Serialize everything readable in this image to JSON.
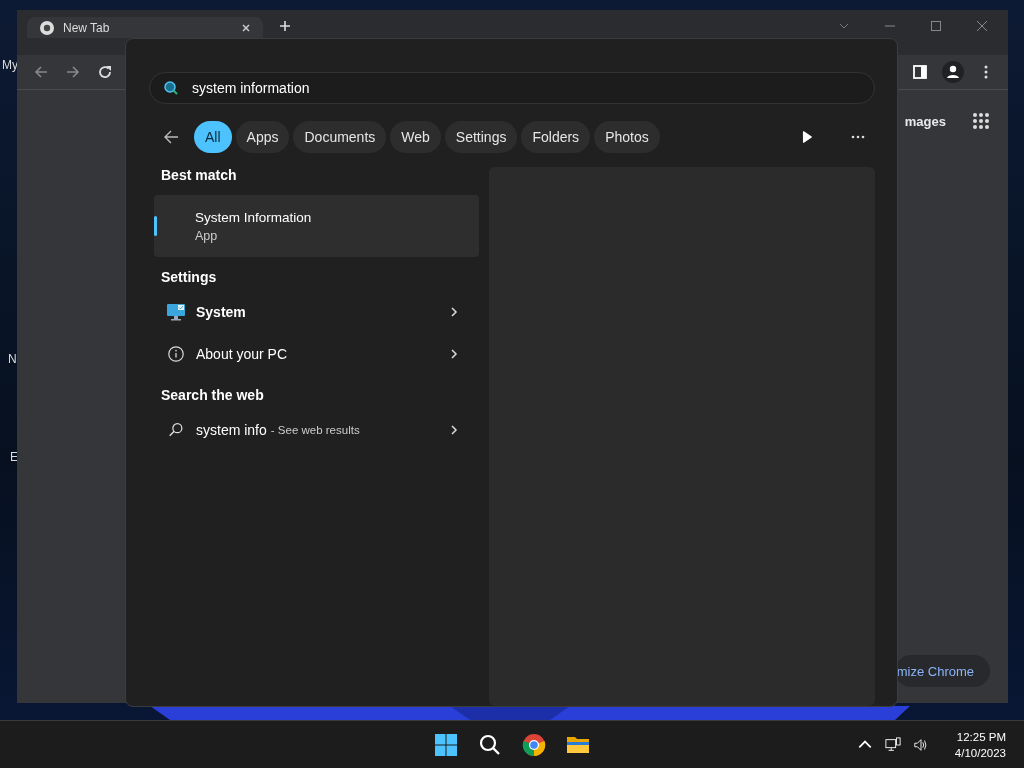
{
  "desktop": {
    "icon_labels": [
      "My",
      "N",
      "E"
    ]
  },
  "browser": {
    "tab": {
      "title": "New Tab"
    },
    "content": {
      "link": "mages",
      "customize_button": "mize Chrome"
    }
  },
  "search": {
    "query": "system information",
    "filters": [
      {
        "label": "All",
        "selected": true
      },
      {
        "label": "Apps",
        "selected": false
      },
      {
        "label": "Documents",
        "selected": false
      },
      {
        "label": "Web",
        "selected": false
      },
      {
        "label": "Settings",
        "selected": false
      },
      {
        "label": "Folders",
        "selected": false
      },
      {
        "label": "Photos",
        "selected": false
      }
    ],
    "best_match": {
      "heading": "Best match",
      "title": "System Information",
      "subtitle": "App",
      "selected": true
    },
    "settings": {
      "heading": "Settings",
      "items": [
        {
          "label": "System",
          "kind": "monitor"
        },
        {
          "label": "About your PC",
          "kind": "info"
        }
      ]
    },
    "web": {
      "heading": "Search the web",
      "query": "system info",
      "hint": "- See web results"
    }
  },
  "taskbar": {
    "time": "12:25 PM",
    "date": "4/10/2023"
  }
}
